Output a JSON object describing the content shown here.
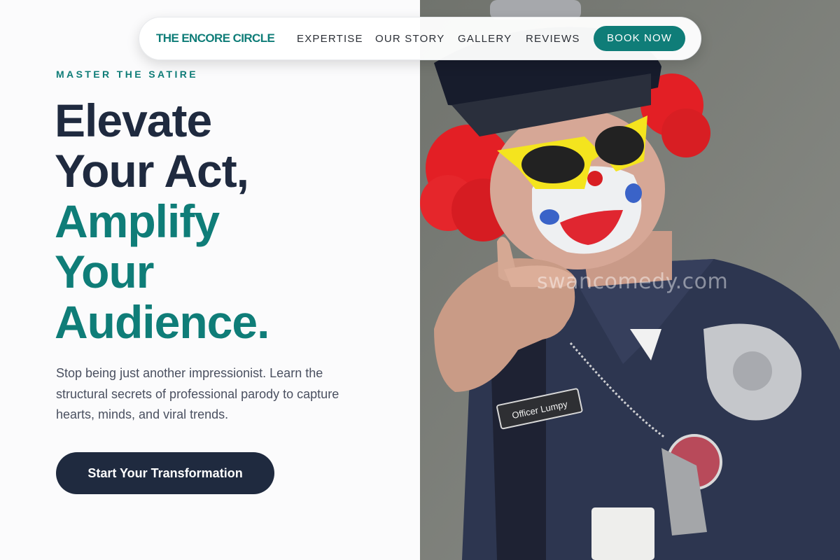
{
  "nav": {
    "brand": "THE ENCORE CIRCLE",
    "links": [
      "EXPERTISE",
      "OUR STORY",
      "GALLERY",
      "REVIEWS"
    ],
    "book_label": "BOOK NOW"
  },
  "hero": {
    "eyebrow": "MASTER THE SATIRE",
    "headline_dark": [
      "Elevate",
      "Your Act,"
    ],
    "headline_teal": [
      "Amplify",
      "Your",
      "Audience."
    ],
    "lead_line1": "Stop being just another impressionist. Learn the",
    "lead_line2": "structural secrets of professional parody to capture",
    "lead_line3": "hearts, minds, and viral trends.",
    "cta_label": "Start Your Transformation"
  },
  "photo": {
    "name_tag": "Officer Lumpy",
    "watermark": "swancomedy.com"
  },
  "colors": {
    "brand": "#0f7d78",
    "navy": "#1f2a3f",
    "text": "#4a5060"
  }
}
